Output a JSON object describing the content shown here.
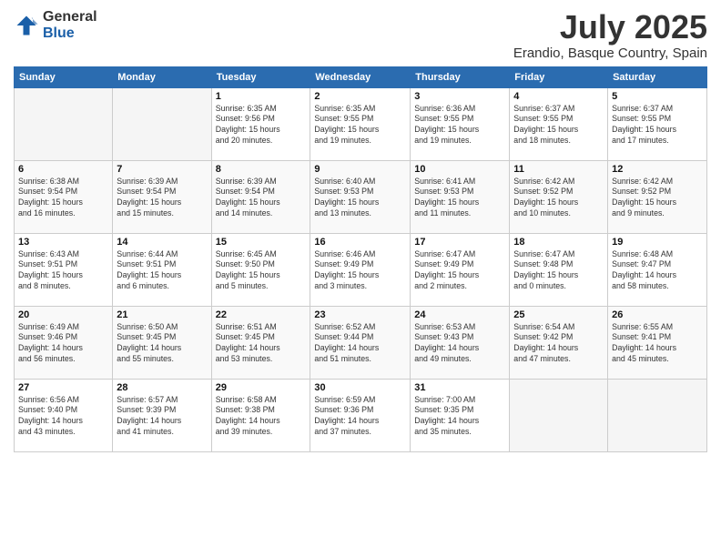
{
  "header": {
    "logo_general": "General",
    "logo_blue": "Blue",
    "month": "July 2025",
    "location": "Erandio, Basque Country, Spain"
  },
  "weekdays": [
    "Sunday",
    "Monday",
    "Tuesday",
    "Wednesday",
    "Thursday",
    "Friday",
    "Saturday"
  ],
  "weeks": [
    [
      {
        "day": "",
        "info": ""
      },
      {
        "day": "",
        "info": ""
      },
      {
        "day": "1",
        "info": "Sunrise: 6:35 AM\nSunset: 9:56 PM\nDaylight: 15 hours\nand 20 minutes."
      },
      {
        "day": "2",
        "info": "Sunrise: 6:35 AM\nSunset: 9:55 PM\nDaylight: 15 hours\nand 19 minutes."
      },
      {
        "day": "3",
        "info": "Sunrise: 6:36 AM\nSunset: 9:55 PM\nDaylight: 15 hours\nand 19 minutes."
      },
      {
        "day": "4",
        "info": "Sunrise: 6:37 AM\nSunset: 9:55 PM\nDaylight: 15 hours\nand 18 minutes."
      },
      {
        "day": "5",
        "info": "Sunrise: 6:37 AM\nSunset: 9:55 PM\nDaylight: 15 hours\nand 17 minutes."
      }
    ],
    [
      {
        "day": "6",
        "info": "Sunrise: 6:38 AM\nSunset: 9:54 PM\nDaylight: 15 hours\nand 16 minutes."
      },
      {
        "day": "7",
        "info": "Sunrise: 6:39 AM\nSunset: 9:54 PM\nDaylight: 15 hours\nand 15 minutes."
      },
      {
        "day": "8",
        "info": "Sunrise: 6:39 AM\nSunset: 9:54 PM\nDaylight: 15 hours\nand 14 minutes."
      },
      {
        "day": "9",
        "info": "Sunrise: 6:40 AM\nSunset: 9:53 PM\nDaylight: 15 hours\nand 13 minutes."
      },
      {
        "day": "10",
        "info": "Sunrise: 6:41 AM\nSunset: 9:53 PM\nDaylight: 15 hours\nand 11 minutes."
      },
      {
        "day": "11",
        "info": "Sunrise: 6:42 AM\nSunset: 9:52 PM\nDaylight: 15 hours\nand 10 minutes."
      },
      {
        "day": "12",
        "info": "Sunrise: 6:42 AM\nSunset: 9:52 PM\nDaylight: 15 hours\nand 9 minutes."
      }
    ],
    [
      {
        "day": "13",
        "info": "Sunrise: 6:43 AM\nSunset: 9:51 PM\nDaylight: 15 hours\nand 8 minutes."
      },
      {
        "day": "14",
        "info": "Sunrise: 6:44 AM\nSunset: 9:51 PM\nDaylight: 15 hours\nand 6 minutes."
      },
      {
        "day": "15",
        "info": "Sunrise: 6:45 AM\nSunset: 9:50 PM\nDaylight: 15 hours\nand 5 minutes."
      },
      {
        "day": "16",
        "info": "Sunrise: 6:46 AM\nSunset: 9:49 PM\nDaylight: 15 hours\nand 3 minutes."
      },
      {
        "day": "17",
        "info": "Sunrise: 6:47 AM\nSunset: 9:49 PM\nDaylight: 15 hours\nand 2 minutes."
      },
      {
        "day": "18",
        "info": "Sunrise: 6:47 AM\nSunset: 9:48 PM\nDaylight: 15 hours\nand 0 minutes."
      },
      {
        "day": "19",
        "info": "Sunrise: 6:48 AM\nSunset: 9:47 PM\nDaylight: 14 hours\nand 58 minutes."
      }
    ],
    [
      {
        "day": "20",
        "info": "Sunrise: 6:49 AM\nSunset: 9:46 PM\nDaylight: 14 hours\nand 56 minutes."
      },
      {
        "day": "21",
        "info": "Sunrise: 6:50 AM\nSunset: 9:45 PM\nDaylight: 14 hours\nand 55 minutes."
      },
      {
        "day": "22",
        "info": "Sunrise: 6:51 AM\nSunset: 9:45 PM\nDaylight: 14 hours\nand 53 minutes."
      },
      {
        "day": "23",
        "info": "Sunrise: 6:52 AM\nSunset: 9:44 PM\nDaylight: 14 hours\nand 51 minutes."
      },
      {
        "day": "24",
        "info": "Sunrise: 6:53 AM\nSunset: 9:43 PM\nDaylight: 14 hours\nand 49 minutes."
      },
      {
        "day": "25",
        "info": "Sunrise: 6:54 AM\nSunset: 9:42 PM\nDaylight: 14 hours\nand 47 minutes."
      },
      {
        "day": "26",
        "info": "Sunrise: 6:55 AM\nSunset: 9:41 PM\nDaylight: 14 hours\nand 45 minutes."
      }
    ],
    [
      {
        "day": "27",
        "info": "Sunrise: 6:56 AM\nSunset: 9:40 PM\nDaylight: 14 hours\nand 43 minutes."
      },
      {
        "day": "28",
        "info": "Sunrise: 6:57 AM\nSunset: 9:39 PM\nDaylight: 14 hours\nand 41 minutes."
      },
      {
        "day": "29",
        "info": "Sunrise: 6:58 AM\nSunset: 9:38 PM\nDaylight: 14 hours\nand 39 minutes."
      },
      {
        "day": "30",
        "info": "Sunrise: 6:59 AM\nSunset: 9:36 PM\nDaylight: 14 hours\nand 37 minutes."
      },
      {
        "day": "31",
        "info": "Sunrise: 7:00 AM\nSunset: 9:35 PM\nDaylight: 14 hours\nand 35 minutes."
      },
      {
        "day": "",
        "info": ""
      },
      {
        "day": "",
        "info": ""
      }
    ]
  ]
}
